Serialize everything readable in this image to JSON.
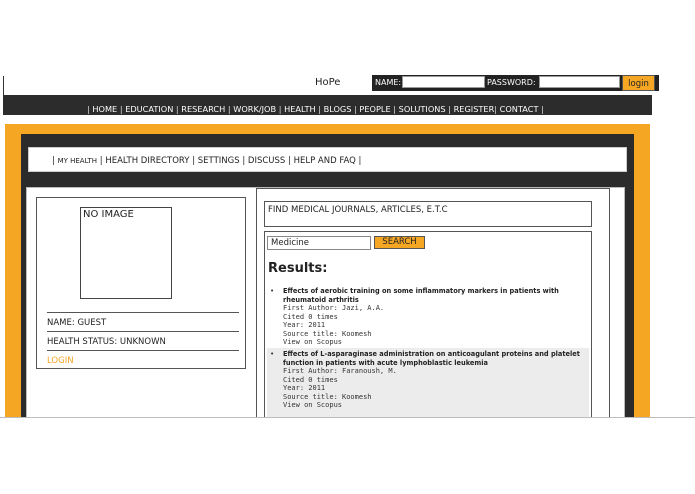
{
  "header": {
    "site_title": "HoPe",
    "name_label": "NAME:",
    "password_label": "PASSWORD:",
    "login_button": "login"
  },
  "topnav": {
    "items": [
      "HOME",
      "EDUCATION",
      "RESEARCH",
      "WORK/JOB",
      "HEALTH",
      "BLOGS",
      "PEOPLE",
      "SOLUTIONS",
      "REGISTER",
      "CONTACT"
    ]
  },
  "subnav": {
    "items": [
      "MY HEALTH",
      "HEALTH DIRECTORY",
      "SETTINGS",
      "DISCUSS",
      "HELP AND FAQ"
    ]
  },
  "profile": {
    "image_placeholder": "NO IMAGE",
    "name": "NAME: GUEST",
    "status": "HEALTH STATUS: UNKNOWN",
    "login_link": "LOGIN"
  },
  "search": {
    "heading": "FIND MEDICAL JOURNALS, ARTICLES, E.T.C",
    "query": "Medicine",
    "button": "SEARCH",
    "results_title": "Results:"
  },
  "results": [
    {
      "title": "Effects of aerobic training on some inflammatory markers in patients with rheumatoid arthritis",
      "author": "First Author: Jazi, A.A.",
      "cited": "Cited 0 times",
      "year": "Year: 2011",
      "source": "Source title: Koomesh",
      "link": "View on Scopus"
    },
    {
      "title": "Effects of L-asparaginase administration on anticoagulant proteins and platelet function in patients with acute lymphoblastic leukemia",
      "author": "First Author: Faranoush, M.",
      "cited": "Cited 0 times",
      "year": "Year: 2011",
      "source": "Source title: Koomesh",
      "link": "View on Scopus"
    }
  ],
  "colors": {
    "accent": "#f5a623",
    "dark": "#2b2b2b"
  }
}
